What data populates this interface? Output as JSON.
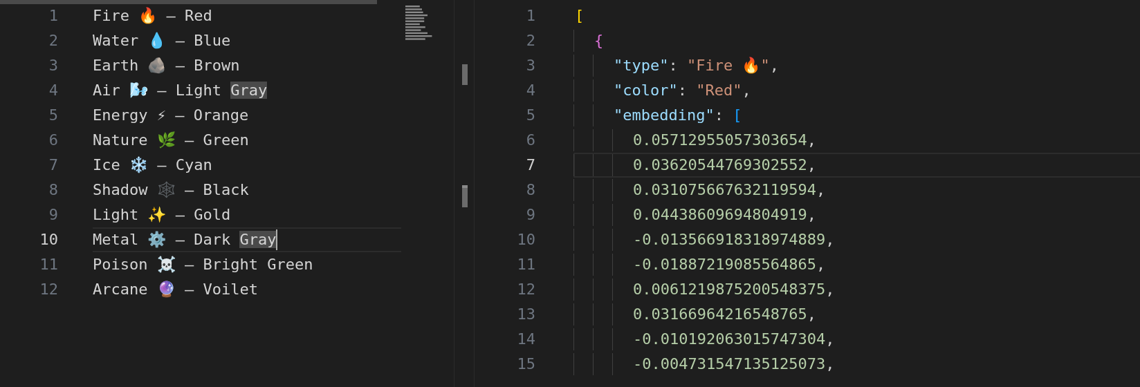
{
  "left_editor": {
    "lines": [
      {
        "number": "1",
        "text": "Fire 🔥 — Red",
        "current": false,
        "cursor": false
      },
      {
        "number": "2",
        "text": "Water 💧 — Blue",
        "current": false,
        "cursor": false
      },
      {
        "number": "3",
        "text": "Earth 🪨 — Brown",
        "current": false,
        "cursor": false
      },
      {
        "number": "4",
        "text": "Air 🌬️ — Light ",
        "highlighted": "Gray",
        "current": false,
        "cursor": false
      },
      {
        "number": "5",
        "text": "Energy ⚡ — Orange",
        "current": false,
        "cursor": false
      },
      {
        "number": "6",
        "text": "Nature 🌿 — Green",
        "current": false,
        "cursor": false
      },
      {
        "number": "7",
        "text": "Ice ❄️ — Cyan",
        "current": false,
        "cursor": false
      },
      {
        "number": "8",
        "text": "Shadow 🕸️ — Black",
        "current": false,
        "cursor": false
      },
      {
        "number": "9",
        "text": "Light ✨ — Gold",
        "current": false,
        "cursor": false
      },
      {
        "number": "10",
        "text": "Metal ⚙️ — Dark ",
        "highlighted": "Gray",
        "current": true,
        "cursor": true
      },
      {
        "number": "11",
        "text": "Poison ☠️ — Bright Green",
        "current": false,
        "cursor": false
      },
      {
        "number": "12",
        "text": "Arcane 🔮 — Voilet",
        "current": false,
        "cursor": false
      }
    ]
  },
  "right_editor": {
    "lines": [
      {
        "number": "1",
        "current": false,
        "tokens": [
          {
            "kind": "bracket1",
            "text": "["
          }
        ],
        "children": [
          {
            "number": "2",
            "current": false,
            "tokens": [
              {
                "kind": "bracket2",
                "text": "{"
              }
            ],
            "children": [
              {
                "number": "3",
                "current": false,
                "tokens": [
                  {
                    "kind": "key",
                    "text": "\"type\""
                  },
                  {
                    "kind": "punct",
                    "text": ": "
                  },
                  {
                    "kind": "string",
                    "text": "\"Fire 🔥\""
                  },
                  {
                    "kind": "punct",
                    "text": ","
                  }
                ]
              },
              {
                "number": "4",
                "current": false,
                "tokens": [
                  {
                    "kind": "key",
                    "text": "\"color\""
                  },
                  {
                    "kind": "punct",
                    "text": ": "
                  },
                  {
                    "kind": "string",
                    "text": "\"Red\""
                  },
                  {
                    "kind": "punct",
                    "text": ","
                  }
                ]
              },
              {
                "number": "5",
                "current": false,
                "tokens": [
                  {
                    "kind": "key",
                    "text": "\"embedding\""
                  },
                  {
                    "kind": "punct",
                    "text": ": "
                  },
                  {
                    "kind": "bracket3",
                    "text": "["
                  }
                ],
                "children": [
                  {
                    "number": "6",
                    "current": false,
                    "tokens": [
                      {
                        "kind": "number",
                        "text": "0.05712955057303654"
                      },
                      {
                        "kind": "punct",
                        "text": ","
                      }
                    ]
                  },
                  {
                    "number": "7",
                    "current": true,
                    "tokens": [
                      {
                        "kind": "number",
                        "text": "0.03620544769302552"
                      },
                      {
                        "kind": "punct",
                        "text": ","
                      }
                    ]
                  },
                  {
                    "number": "8",
                    "current": false,
                    "tokens": [
                      {
                        "kind": "number",
                        "text": "0.031075667632119594"
                      },
                      {
                        "kind": "punct",
                        "text": ","
                      }
                    ]
                  },
                  {
                    "number": "9",
                    "current": false,
                    "tokens": [
                      {
                        "kind": "number",
                        "text": "0.04438609694804919"
                      },
                      {
                        "kind": "punct",
                        "text": ","
                      }
                    ]
                  },
                  {
                    "number": "10",
                    "current": false,
                    "tokens": [
                      {
                        "kind": "number",
                        "text": "-0.013566918318974889"
                      },
                      {
                        "kind": "punct",
                        "text": ","
                      }
                    ]
                  },
                  {
                    "number": "11",
                    "current": false,
                    "tokens": [
                      {
                        "kind": "number",
                        "text": "-0.01887219085564865"
                      },
                      {
                        "kind": "punct",
                        "text": ","
                      }
                    ]
                  },
                  {
                    "number": "12",
                    "current": false,
                    "tokens": [
                      {
                        "kind": "number",
                        "text": "0.0061219875200548375"
                      },
                      {
                        "kind": "punct",
                        "text": ","
                      }
                    ]
                  },
                  {
                    "number": "13",
                    "current": false,
                    "tokens": [
                      {
                        "kind": "number",
                        "text": "0.03166964216548765"
                      },
                      {
                        "kind": "punct",
                        "text": ","
                      }
                    ]
                  },
                  {
                    "number": "14",
                    "current": false,
                    "tokens": [
                      {
                        "kind": "number",
                        "text": "-0.010192063015747304"
                      },
                      {
                        "kind": "punct",
                        "text": ","
                      }
                    ]
                  },
                  {
                    "number": "15",
                    "current": false,
                    "tokens": [
                      {
                        "kind": "number",
                        "text": "-0.004731547135125073"
                      },
                      {
                        "kind": "punct",
                        "text": ","
                      }
                    ]
                  }
                ]
              }
            ]
          }
        ]
      }
    ]
  }
}
